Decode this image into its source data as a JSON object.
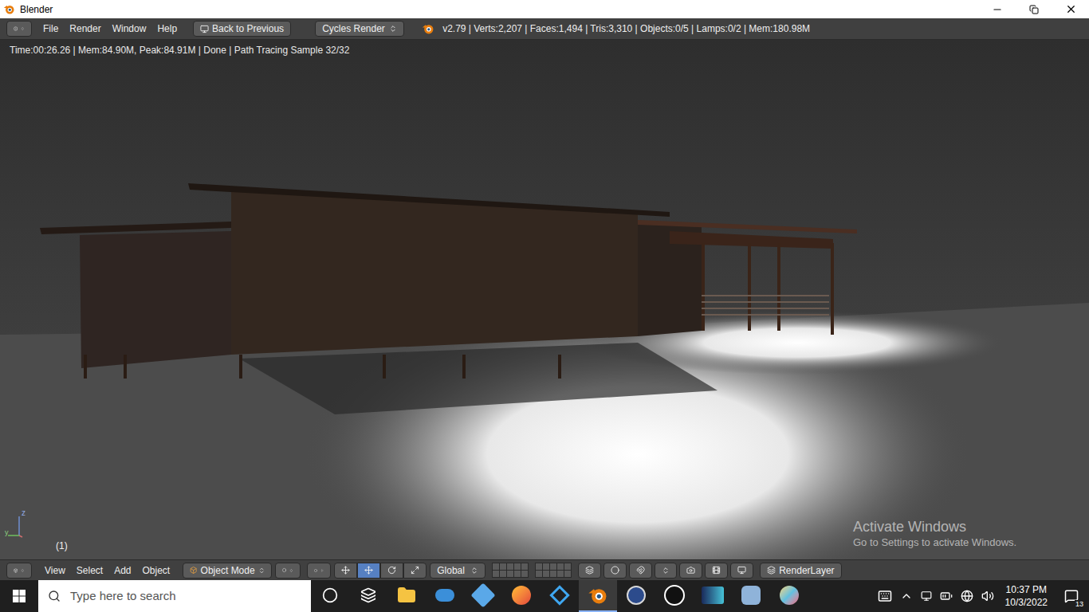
{
  "window": {
    "title": "Blender"
  },
  "info_header": {
    "menus": [
      "File",
      "Render",
      "Window",
      "Help"
    ],
    "back_button": "Back to Previous",
    "render_engine": "Cycles Render",
    "stats": "v2.79 | Verts:2,207 | Faces:1,494 | Tris:3,310 | Objects:0/5 | Lamps:0/2 | Mem:180.98M"
  },
  "render_view": {
    "status": "Time:00:26.26 | Mem:84.90M, Peak:84.91M | Done | Path Tracing Sample 32/32",
    "frame": "(1)",
    "axis_labels": [
      "z",
      "y"
    ]
  },
  "view3d_header": {
    "menus": [
      "View",
      "Select",
      "Add",
      "Object"
    ],
    "mode": "Object Mode",
    "orientation": "Global",
    "render_layer": "RenderLayer"
  },
  "watermark": {
    "title": "Activate Windows",
    "subtitle": "Go to Settings to activate Windows."
  },
  "taskbar": {
    "search_placeholder": "Type here to search",
    "apps": [
      {
        "kind": "cortana",
        "active": false
      },
      {
        "kind": "taskview",
        "active": false
      },
      {
        "kind": "explorer",
        "active": false
      },
      {
        "kind": "dolphin",
        "active": false
      },
      {
        "kind": "ppsspp",
        "active": false
      },
      {
        "kind": "firefox",
        "active": false
      },
      {
        "kind": "diamond",
        "active": false
      },
      {
        "kind": "blender",
        "active": true
      },
      {
        "kind": "media",
        "active": false
      },
      {
        "kind": "unreal",
        "active": false
      },
      {
        "kind": "game",
        "active": false
      },
      {
        "kind": "bluebird",
        "active": false
      },
      {
        "kind": "paint",
        "active": false
      }
    ],
    "time": "10:37 PM",
    "date": "10/3/2022",
    "notifications": "13"
  }
}
